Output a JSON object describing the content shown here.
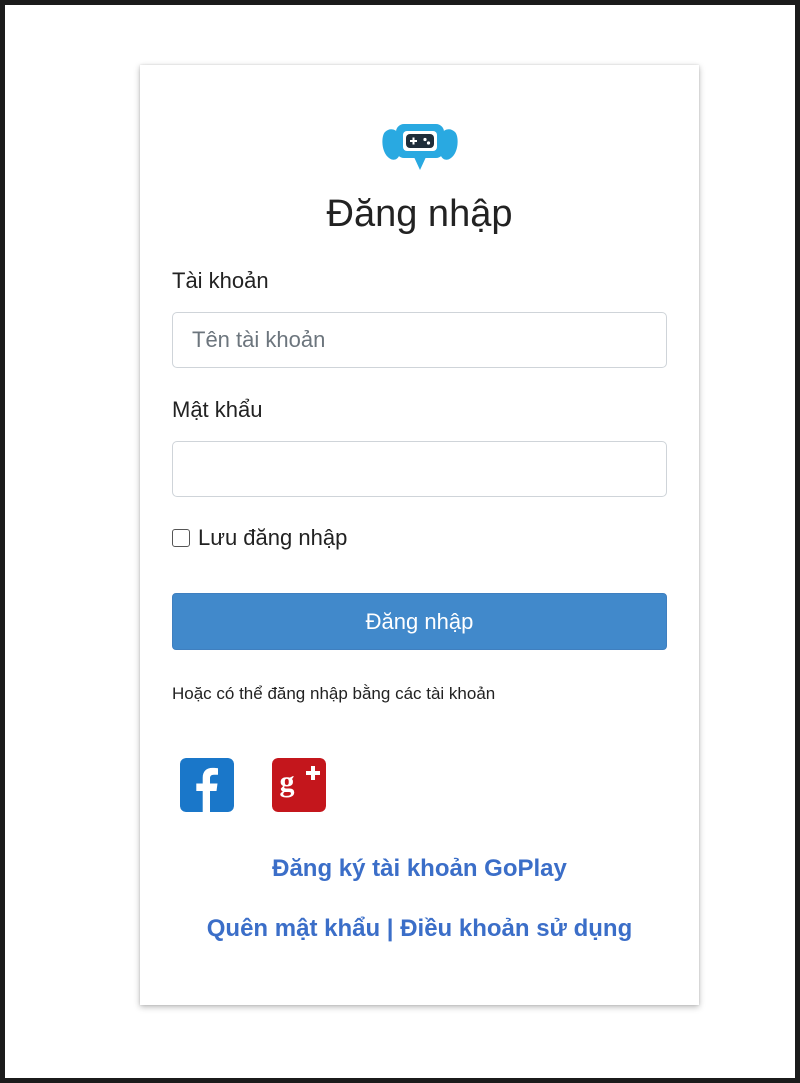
{
  "header": {
    "title": "Đăng nhập"
  },
  "form": {
    "username_label": "Tài khoản",
    "username_placeholder": "Tên tài khoản",
    "username_value": "",
    "password_label": "Mật khẩu",
    "password_value": "",
    "remember_label": "Lưu đăng nhập",
    "remember_checked": false,
    "submit_label": "Đăng nhập"
  },
  "social": {
    "prompt": "Hoặc có thể đăng nhập bằng các tài khoản",
    "providers": [
      "facebook-icon",
      "google-plus-icon"
    ]
  },
  "links": {
    "register": "Đăng ký tài khoản GoPlay",
    "forgot_password": "Quên mật khẩu",
    "separator": "|",
    "terms": "Điều khoản sử dụng"
  },
  "colors": {
    "primary_button": "#4189cb",
    "link": "#3b6ec8",
    "facebook": "#1a77c9",
    "google_plus": "#c4161c",
    "logo": "#29a9e1"
  }
}
